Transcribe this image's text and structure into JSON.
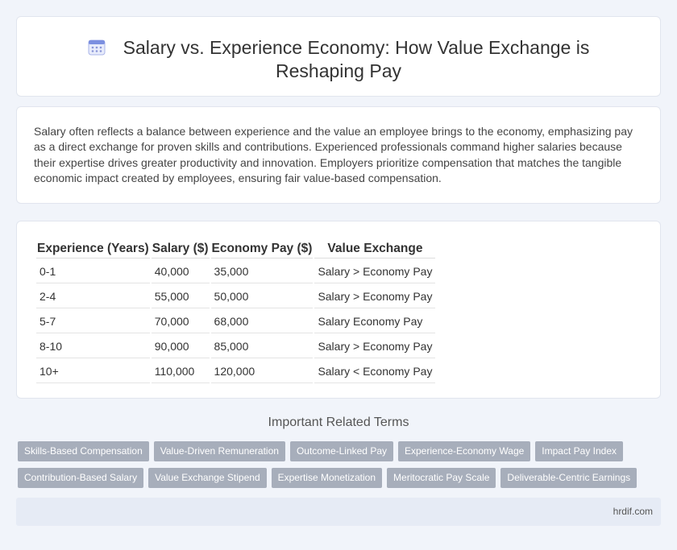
{
  "header": {
    "icon": "calendar-icon",
    "title": "Salary vs. Experience Economy: How Value Exchange is Reshaping Pay"
  },
  "intro": {
    "text": "Salary often reflects a balance between experience and the value an employee brings to the economy, emphasizing pay as a direct exchange for proven skills and contributions. Experienced professionals command higher salaries because their expertise drives greater productivity and innovation. Employers prioritize compensation that matches the tangible economic impact created by employees, ensuring fair value-based compensation."
  },
  "table": {
    "headers": [
      "Experience (Years)",
      "Salary ($)",
      "Economy Pay ($)",
      "Value Exchange"
    ],
    "rows": [
      [
        "0-1",
        "40,000",
        "35,000",
        "Salary > Economy Pay"
      ],
      [
        "2-4",
        "55,000",
        "50,000",
        "Salary > Economy Pay"
      ],
      [
        "5-7",
        "70,000",
        "68,000",
        "Salary Economy Pay"
      ],
      [
        "8-10",
        "90,000",
        "85,000",
        "Salary > Economy Pay"
      ],
      [
        "10+",
        "110,000",
        "120,000",
        "Salary < Economy Pay"
      ]
    ]
  },
  "related": {
    "title": "Important Related Terms",
    "tags": [
      "Skills-Based Compensation",
      "Value-Driven Remuneration",
      "Outcome-Linked Pay",
      "Experience-Economy Wage",
      "Impact Pay Index",
      "Contribution-Based Salary",
      "Value Exchange Stipend",
      "Expertise Monetization",
      "Meritocratic Pay Scale",
      "Deliverable-Centric Earnings"
    ]
  },
  "footer": {
    "site": "hrdif.com"
  },
  "colors": {
    "background": "#f1f4fa",
    "tag": "#a7aebb",
    "footer": "#e6ebf5",
    "icon_accent": "#6c7fd8"
  }
}
